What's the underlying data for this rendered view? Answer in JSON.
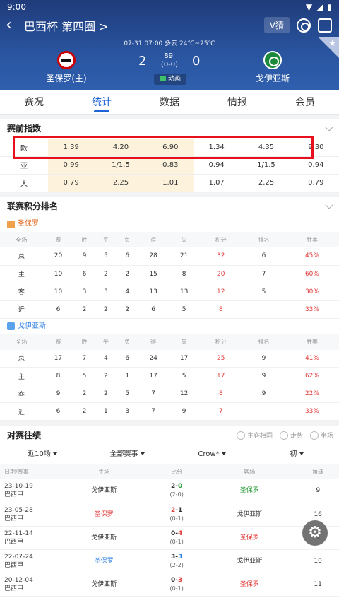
{
  "status": {
    "time": "9:00"
  },
  "nav": {
    "title": "巴西杯 第四圈 >",
    "vip_label": "V猜"
  },
  "match": {
    "meta": "07-31 07:00   多云 24℃~25℃",
    "home": {
      "name": "圣保罗(主)",
      "score": "2"
    },
    "away": {
      "name": "戈伊亚斯",
      "score": "0"
    },
    "minute": "89'",
    "halftime": "(0-0)",
    "animation_label": "动画"
  },
  "tabs": [
    "赛况",
    "统计",
    "数据",
    "情报",
    "会员"
  ],
  "odds": {
    "title": "赛前指数",
    "rows": [
      {
        "label": "欧",
        "v": [
          "1.39",
          "4.20",
          "6.90",
          "1.34",
          "4.35",
          "9.30"
        ]
      },
      {
        "label": "亚",
        "v": [
          "0.99",
          "1/1.5",
          "0.83",
          "0.94",
          "1/1.5",
          "0.94"
        ]
      },
      {
        "label": "大",
        "v": [
          "0.79",
          "2.25",
          "1.01",
          "1.07",
          "2.25",
          "0.79"
        ]
      }
    ]
  },
  "standings": {
    "title": "联赛积分排名",
    "headers": [
      "全场",
      "赛",
      "胜",
      "平",
      "负",
      "得",
      "失",
      "积分",
      "排名",
      "胜率"
    ],
    "teams": [
      {
        "name": "圣保罗",
        "rows": [
          [
            "总",
            "20",
            "9",
            "5",
            "6",
            "28",
            "21",
            "32",
            "6",
            "45%"
          ],
          [
            "主",
            "10",
            "6",
            "2",
            "2",
            "15",
            "8",
            "20",
            "7",
            "60%"
          ],
          [
            "客",
            "10",
            "3",
            "3",
            "4",
            "13",
            "13",
            "12",
            "5",
            "30%"
          ],
          [
            "近",
            "6",
            "2",
            "2",
            "2",
            "6",
            "5",
            "8",
            "",
            "33%"
          ]
        ]
      },
      {
        "name": "戈伊亚斯",
        "rows": [
          [
            "总",
            "17",
            "7",
            "4",
            "6",
            "24",
            "17",
            "25",
            "9",
            "41%"
          ],
          [
            "主",
            "8",
            "5",
            "2",
            "1",
            "17",
            "5",
            "17",
            "9",
            "62%"
          ],
          [
            "客",
            "9",
            "2",
            "2",
            "5",
            "7",
            "12",
            "8",
            "9",
            "22%"
          ],
          [
            "近",
            "6",
            "2",
            "1",
            "3",
            "7",
            "9",
            "7",
            "",
            "33%"
          ]
        ]
      }
    ]
  },
  "h2h": {
    "title": "对赛往绩",
    "options": [
      "主客相同",
      "走势",
      "半场"
    ],
    "filters": [
      "近10场",
      "全部赛事",
      "Crow*",
      "初"
    ],
    "headers": [
      "日期/赛事",
      "主场",
      "比分",
      "客场",
      "角球"
    ],
    "rows": [
      {
        "date": "23-10-19",
        "league": "巴西甲",
        "home": "戈伊亚斯",
        "home_c": "",
        "score": "2-0",
        "ht": "(2-0)",
        "away": "圣保罗",
        "away_c": "green",
        "corner": "9"
      },
      {
        "date": "23-05-28",
        "league": "巴西甲",
        "home": "圣保罗",
        "home_c": "red",
        "score": "2-1",
        "ht": "(0-1)",
        "away": "戈伊亚斯",
        "away_c": "",
        "corner": "16"
      },
      {
        "date": "22-11-14",
        "league": "巴西甲",
        "home": "戈伊亚斯",
        "home_c": "",
        "score": "0-4",
        "ht": "(0-1)",
        "away": "圣保罗",
        "away_c": "red",
        "corner": "7"
      },
      {
        "date": "22-07-24",
        "league": "巴西甲",
        "home": "圣保罗",
        "home_c": "blue",
        "score": "3-3",
        "ht": "(2-2)",
        "away": "戈伊亚斯",
        "away_c": "",
        "corner": "10"
      },
      {
        "date": "20-12-04",
        "league": "巴西甲",
        "home": "戈伊亚斯",
        "home_c": "",
        "score": "0-3",
        "ht": "(0-1)",
        "away": "圣保罗",
        "away_c": "red",
        "corner": "11"
      }
    ]
  },
  "colors": {
    "accent": "#1e63d6",
    "highlight": "#e8101c",
    "header": "#2a55a0"
  }
}
